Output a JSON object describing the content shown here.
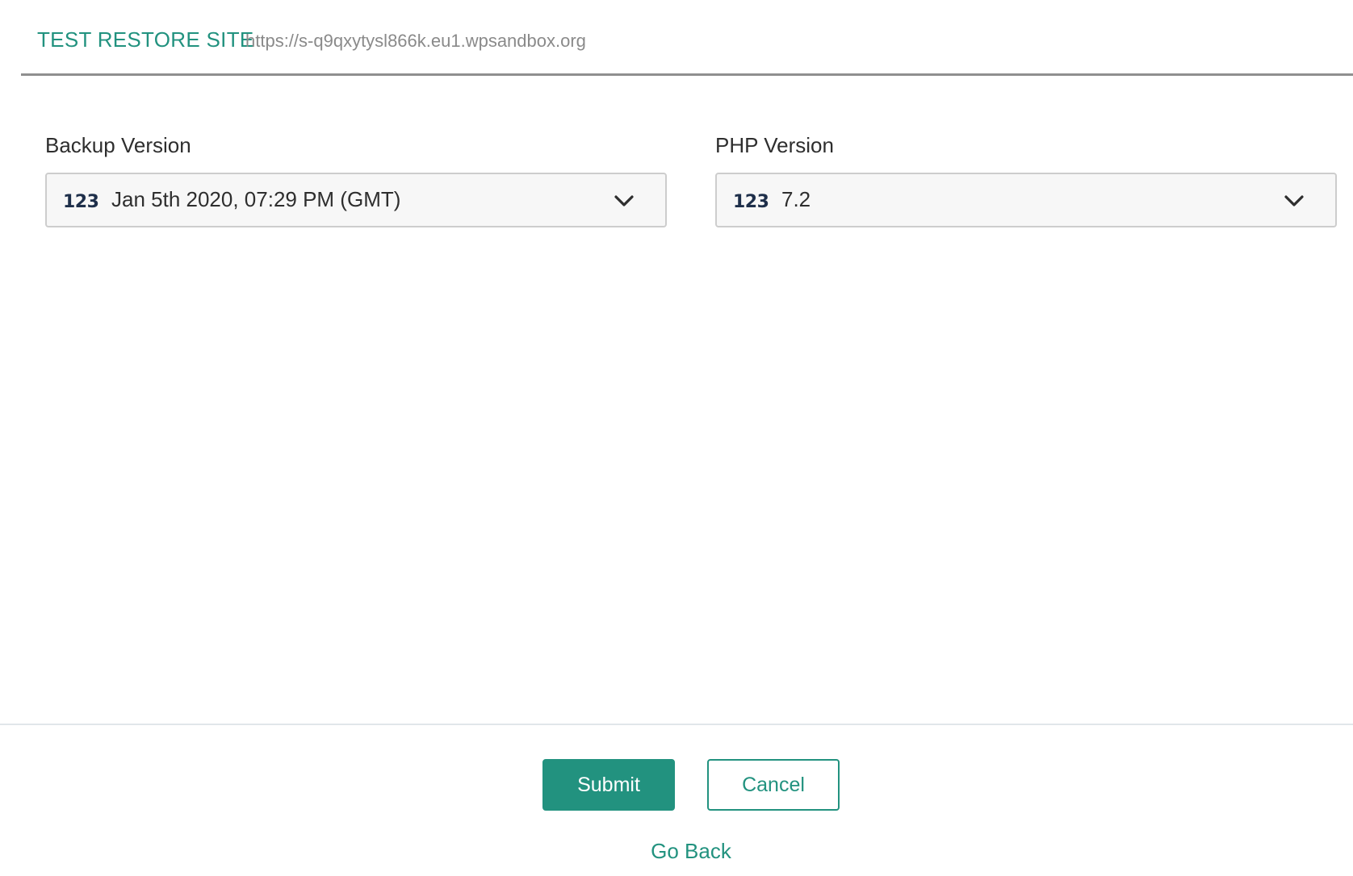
{
  "header": {
    "title": "TEST RESTORE SITE",
    "url": "https://s-q9qxytysl866k.eu1.wpsandbox.org"
  },
  "fields": {
    "backup": {
      "label": "Backup Version",
      "icon": "123",
      "value": "Jan 5th 2020, 07:29 PM (GMT)"
    },
    "php": {
      "label": "PHP Version",
      "icon": "123",
      "value": "7.2"
    }
  },
  "actions": {
    "submit_label": "Submit",
    "cancel_label": "Cancel",
    "go_back_label": "Go Back"
  },
  "colors": {
    "accent": "#22927f",
    "text": "#2e2e2e",
    "muted": "#8a8a8a",
    "icon": "#1e2f4a"
  }
}
